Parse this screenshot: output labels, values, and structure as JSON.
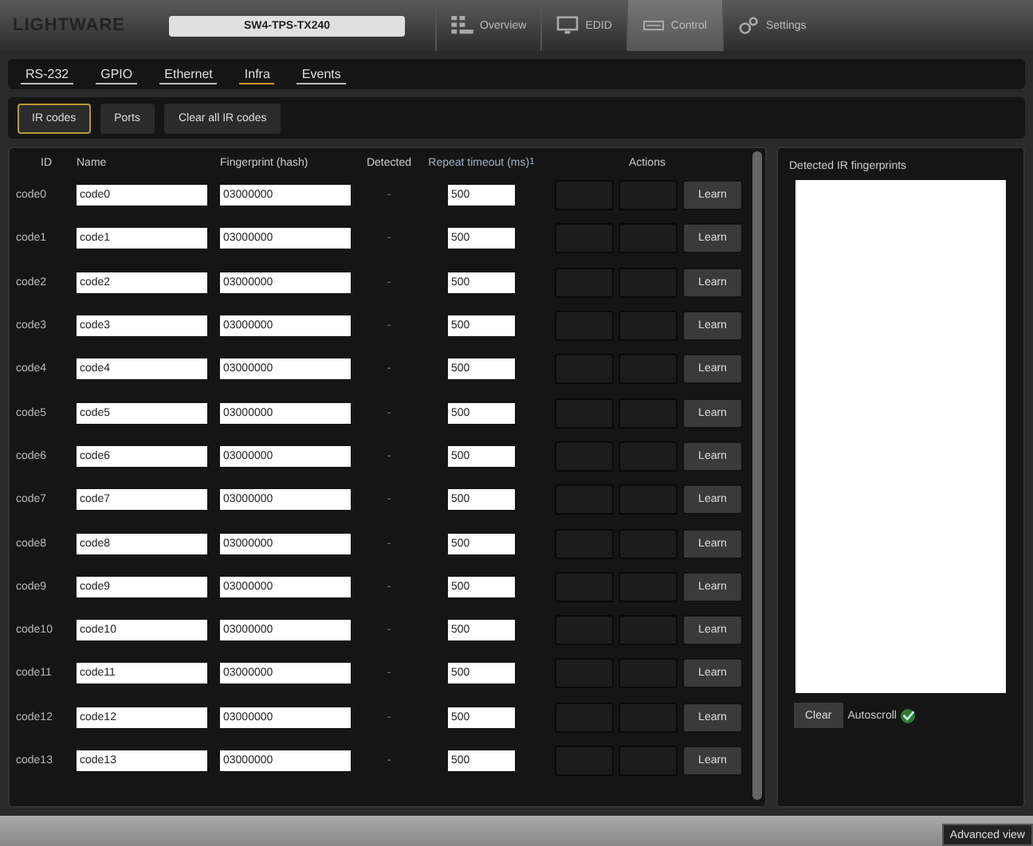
{
  "header": {
    "logo": "LIGHTWARE",
    "device": "SW4-TPS-TX240",
    "nav": [
      {
        "label": "Overview",
        "selected": false
      },
      {
        "label": "EDID",
        "selected": false
      },
      {
        "label": "Control",
        "selected": true
      },
      {
        "label": "Settings",
        "selected": false
      }
    ]
  },
  "subtabs": [
    {
      "label": "RS-232",
      "selected": false
    },
    {
      "label": "GPIO",
      "selected": false
    },
    {
      "label": "Ethernet",
      "selected": false
    },
    {
      "label": "Infra",
      "selected": true
    },
    {
      "label": "Events",
      "selected": false
    }
  ],
  "toolbar": [
    {
      "label": "IR codes",
      "selected": true
    },
    {
      "label": "Ports",
      "selected": false
    },
    {
      "label": "Clear all IR codes",
      "selected": false
    }
  ],
  "table": {
    "columns": [
      "ID",
      "Name",
      "Fingerprint (hash)",
      "Detected",
      "Repeat timeout (ms)",
      "Actions"
    ],
    "timeout_mark": "1",
    "rows": [
      {
        "id": "code0",
        "name": "code0",
        "fingerprint": "03000000",
        "detected": "-",
        "timeout": "500",
        "action": "Learn"
      },
      {
        "id": "code1",
        "name": "code1",
        "fingerprint": "03000000",
        "detected": "-",
        "timeout": "500",
        "action": "Learn"
      },
      {
        "id": "code2",
        "name": "code2",
        "fingerprint": "03000000",
        "detected": "-",
        "timeout": "500",
        "action": "Learn"
      },
      {
        "id": "code3",
        "name": "code3",
        "fingerprint": "03000000",
        "detected": "-",
        "timeout": "500",
        "action": "Learn"
      },
      {
        "id": "code4",
        "name": "code4",
        "fingerprint": "03000000",
        "detected": "-",
        "timeout": "500",
        "action": "Learn"
      },
      {
        "id": "code5",
        "name": "code5",
        "fingerprint": "03000000",
        "detected": "-",
        "timeout": "500",
        "action": "Learn"
      },
      {
        "id": "code6",
        "name": "code6",
        "fingerprint": "03000000",
        "detected": "-",
        "timeout": "500",
        "action": "Learn"
      },
      {
        "id": "code7",
        "name": "code7",
        "fingerprint": "03000000",
        "detected": "-",
        "timeout": "500",
        "action": "Learn"
      },
      {
        "id": "code8",
        "name": "code8",
        "fingerprint": "03000000",
        "detected": "-",
        "timeout": "500",
        "action": "Learn"
      },
      {
        "id": "code9",
        "name": "code9",
        "fingerprint": "03000000",
        "detected": "-",
        "timeout": "500",
        "action": "Learn"
      },
      {
        "id": "code10",
        "name": "code10",
        "fingerprint": "03000000",
        "detected": "-",
        "timeout": "500",
        "action": "Learn"
      },
      {
        "id": "code11",
        "name": "code11",
        "fingerprint": "03000000",
        "detected": "-",
        "timeout": "500",
        "action": "Learn"
      },
      {
        "id": "code12",
        "name": "code12",
        "fingerprint": "03000000",
        "detected": "-",
        "timeout": "500",
        "action": "Learn"
      },
      {
        "id": "code13",
        "name": "code13",
        "fingerprint": "03000000",
        "detected": "-",
        "timeout": "500",
        "action": "Learn"
      }
    ]
  },
  "detected_panel": {
    "title": "Detected IR fingerprints",
    "clear_button": "Clear",
    "autoscroll": {
      "label": "Autoscroll",
      "checked": true
    }
  },
  "footer": {
    "button": "Advanced view"
  }
}
